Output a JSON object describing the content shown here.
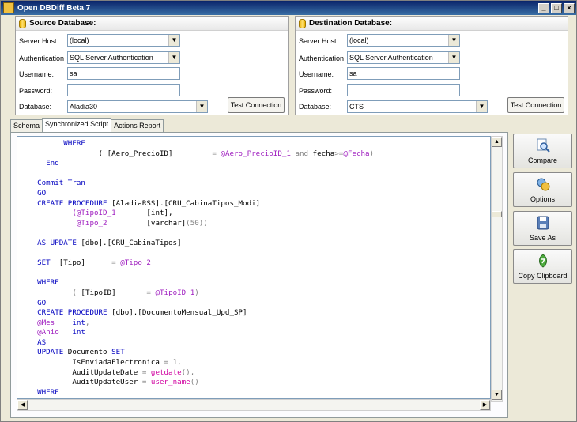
{
  "window": {
    "title": "Open DBDiff Beta 7",
    "min": "_",
    "max": "□",
    "close": "×"
  },
  "source": {
    "heading": "Source Database:",
    "server_host_label": "Server Host:",
    "server_host": "(local)",
    "auth_label": "Authentication",
    "auth": "SQL Server Authentication",
    "username_label": "Username:",
    "username": "sa",
    "password_label": "Password:",
    "password": "",
    "database_label": "Database:",
    "database": "Aladia30",
    "test_button": "Test Connection"
  },
  "destination": {
    "heading": "Destination Database:",
    "server_host_label": "Server Host:",
    "server_host": "(local)",
    "auth_label": "Authentication",
    "auth": "SQL Server Authentication",
    "username_label": "Username:",
    "username": "sa",
    "password_label": "Password:",
    "password": "",
    "database_label": "Database:",
    "database": "CTS",
    "test_button": "Test Connection"
  },
  "tabs": [
    "Schema",
    "Synchronized Script",
    "Actions Report"
  ],
  "active_tab": "Synchronized Script",
  "sidebar": {
    "compare": "Compare",
    "options": "Options",
    "save_as": "Save As",
    "copy_clipboard": "Copy Clipboard"
  },
  "code_lines": [
    [
      [
        "kw",
        "        WHERE"
      ]
    ],
    [
      [
        "",
        "                ( [Aero_PrecioID]         "
      ],
      [
        "op",
        "= "
      ],
      [
        "v",
        "@Aero_PrecioID_1"
      ],
      [
        "op",
        " and "
      ],
      [
        "",
        "fecha"
      ],
      [
        "op",
        ">="
      ],
      [
        "v",
        "@Fecha"
      ],
      [
        "op",
        ")"
      ]
    ],
    [
      [
        "kw",
        "    End"
      ]
    ],
    [
      [
        "",
        ""
      ]
    ],
    [
      [
        "kw",
        "  Commit Tran"
      ]
    ],
    [
      [
        "kw",
        "  GO"
      ]
    ],
    [
      [
        "kw",
        "  CREATE PROCEDURE "
      ],
      [
        "",
        "[AladiaRSS].[CRU_CabinaTipos_Modi]"
      ]
    ],
    [
      [
        "",
        "          "
      ],
      [
        "v",
        "(@TipoID_1"
      ],
      [
        "",
        "       [int],"
      ]
    ],
    [
      [
        "",
        "           "
      ],
      [
        "v",
        "@Tipo_2"
      ],
      [
        "",
        "         [varchar]"
      ],
      [
        "op",
        "(50))"
      ]
    ],
    [
      [
        "",
        ""
      ]
    ],
    [
      [
        "kw",
        "  AS UPDATE "
      ],
      [
        "",
        "[dbo].[CRU_CabinaTipos]"
      ]
    ],
    [
      [
        "",
        ""
      ]
    ],
    [
      [
        "kw",
        "  SET  "
      ],
      [
        "",
        "[Tipo]      "
      ],
      [
        "op",
        "= "
      ],
      [
        "v",
        "@Tipo_2"
      ]
    ],
    [
      [
        "",
        ""
      ]
    ],
    [
      [
        "kw",
        "  WHERE"
      ]
    ],
    [
      [
        "",
        "          "
      ],
      [
        "op",
        "( "
      ],
      [
        "",
        "[TipoID]       "
      ],
      [
        "op",
        "= "
      ],
      [
        "v",
        "@TipoID_1"
      ],
      [
        "op",
        ")"
      ]
    ],
    [
      [
        "kw",
        "  GO"
      ]
    ],
    [
      [
        "kw",
        "  CREATE PROCEDURE "
      ],
      [
        "",
        "[dbo].[DocumentoMensual_Upd_SP]"
      ]
    ],
    [
      [
        "v",
        "  @Mes"
      ],
      [
        "kw",
        "    int"
      ],
      [
        "op",
        ","
      ]
    ],
    [
      [
        "v",
        "  @Anio"
      ],
      [
        "kw",
        "   int"
      ]
    ],
    [
      [
        "kw",
        "  AS"
      ]
    ],
    [
      [
        "kw",
        "  UPDATE "
      ],
      [
        "",
        "Documento "
      ],
      [
        "kw",
        "SET"
      ]
    ],
    [
      [
        "",
        "          IsEnviadaElectronica "
      ],
      [
        "op",
        "= "
      ],
      [
        "",
        "1"
      ],
      [
        "op",
        ","
      ]
    ],
    [
      [
        "",
        "          AuditUpdateDate "
      ],
      [
        "op",
        "= "
      ],
      [
        "fn",
        "getdate"
      ],
      [
        "op",
        "(),"
      ]
    ],
    [
      [
        "",
        "          AuditUpdateUser "
      ],
      [
        "op",
        "= "
      ],
      [
        "fn",
        "user_name"
      ],
      [
        "op",
        "()"
      ]
    ],
    [
      [
        "kw",
        "  WHERE"
      ]
    ]
  ]
}
